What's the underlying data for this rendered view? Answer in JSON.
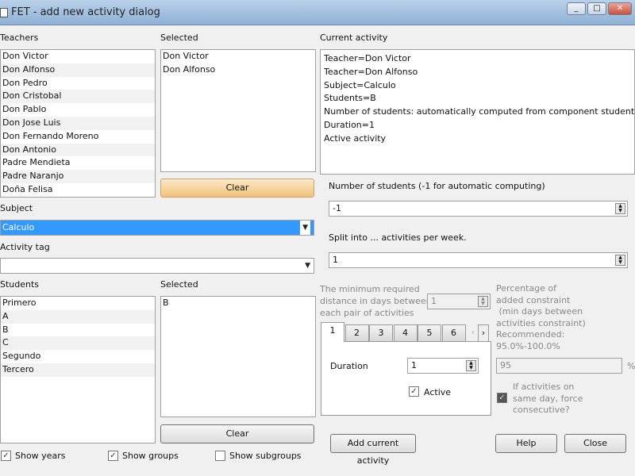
{
  "window": {
    "title": "FET - add new activity dialog",
    "min": "_",
    "max": "□",
    "close": "✕"
  },
  "teachers": {
    "label": "Teachers",
    "items": [
      "Don Victor",
      "Don Alfonso",
      "Don Pedro",
      "Don Cristobal",
      "Don Pablo",
      "Don Jose Luis",
      "Don Fernando Moreno",
      "Don Antonio",
      "Padre Mendieta",
      "Padre Naranjo",
      "Doña Felisa"
    ]
  },
  "teachers_selected": {
    "label": "Selected",
    "items": [
      "Don Victor",
      "Don Alfonso"
    ],
    "clear": "Clear"
  },
  "subject": {
    "label": "Subject",
    "value": "Calculo"
  },
  "activity_tag": {
    "label": "Activity tag",
    "value": ""
  },
  "students": {
    "label": "Students",
    "items": [
      "Primero",
      "A",
      "B",
      "C",
      "Segundo",
      "Tercero"
    ]
  },
  "students_selected": {
    "label": "Selected",
    "items": [
      "B"
    ],
    "clear": "Clear"
  },
  "show": {
    "years": "Show years",
    "groups": "Show groups",
    "subgroups": "Show subgroups"
  },
  "current": {
    "label": "Current activity",
    "lines": [
      "Teacher=Don Victor",
      "Teacher=Don Alfonso",
      "Subject=Calculo",
      "Students=B",
      "Number of students: automatically computed from component students sets",
      "Duration=1",
      "Active activity"
    ]
  },
  "num_students": {
    "label": "Number of students (-1 for automatic computing)",
    "value": "-1"
  },
  "split": {
    "label": "Split into ... activities per week.",
    "value": "1"
  },
  "min_days": {
    "label1": "The minimum required",
    "label2": "distance in days between",
    "label3": "each pair of activities",
    "value": "1"
  },
  "percentage": {
    "l1": "Percentage of",
    "l2": "added constraint",
    "l3": " (min days between",
    "l4": "activities constraint)",
    "l5": "Recommended:",
    "l6": "95.0%-100.0%",
    "value": "95",
    "unit": "%"
  },
  "consecutive": {
    "l1": "If activities on",
    "l2": "same day, force",
    "l3": "consecutive?"
  },
  "tabs": [
    "1",
    "2",
    "3",
    "4",
    "5",
    "6"
  ],
  "duration": {
    "label": "Duration",
    "value": "1",
    "active": "Active"
  },
  "buttons": {
    "add": "Add current activity",
    "help": "Help",
    "close": "Close"
  }
}
